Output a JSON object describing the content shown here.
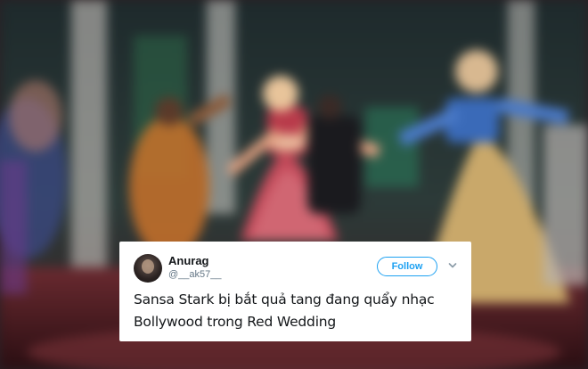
{
  "tweet": {
    "author_name": "Anurag",
    "author_handle": "@__ak57__",
    "follow_label": "Follow",
    "text": "Sansa Stark bị bắt quả tang đang quẩy nhạc Bollywood trong Red Wedding"
  },
  "icons": {
    "menu": "chevron-down-icon",
    "avatar": "avatar"
  },
  "colors": {
    "accent": "#1da1f2",
    "text": "#14171a",
    "muted": "#657786"
  }
}
